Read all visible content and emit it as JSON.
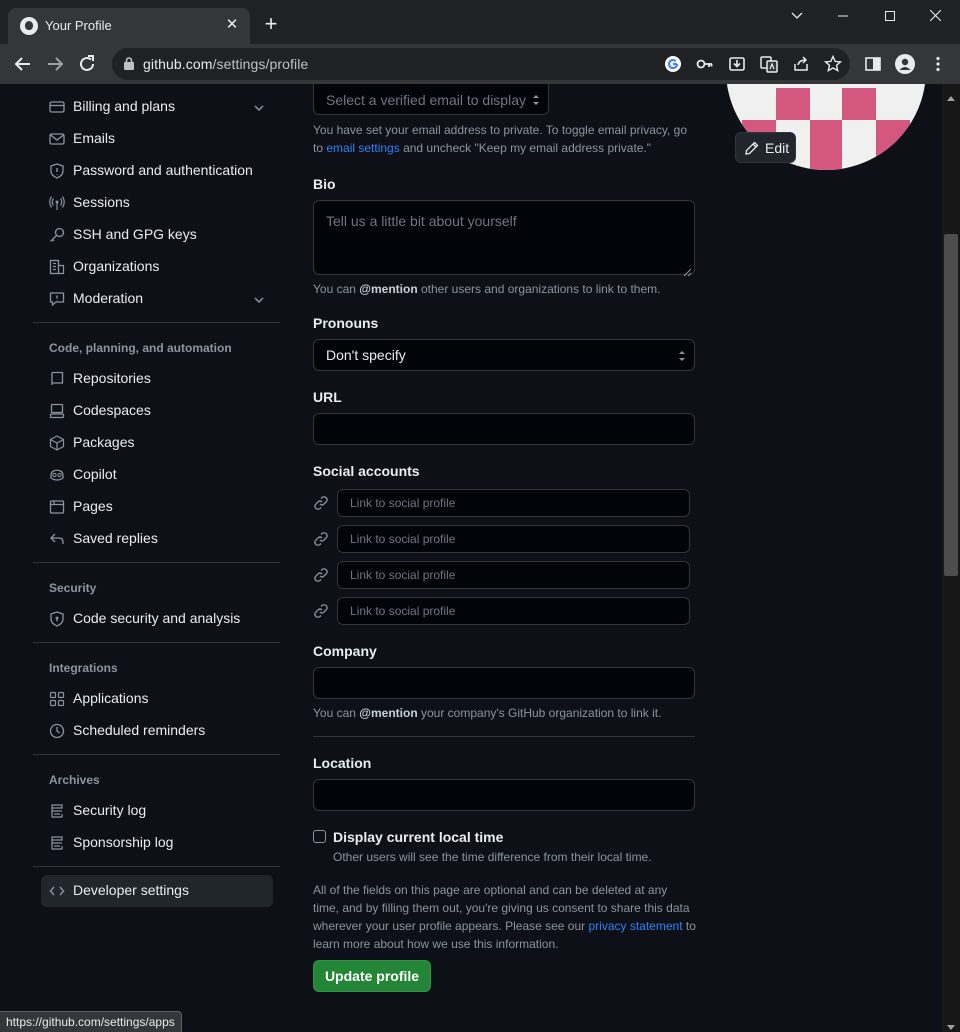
{
  "browser": {
    "tab_title": "Your Profile",
    "tab_close": "✕",
    "new_tab": "+",
    "window_controls": {
      "dropdown": "⌄",
      "minimize": "—",
      "maximize": "☐",
      "close": "✕"
    },
    "url_host": "github.com",
    "url_path": "/settings/profile",
    "status_url": "https://github.com/settings/apps"
  },
  "sidebar": {
    "items_top": [
      {
        "label": "Billing and plans",
        "icon": "credit-card-icon",
        "expandable": true
      },
      {
        "label": "Emails",
        "icon": "mail-icon"
      },
      {
        "label": "Password and authentication",
        "icon": "shield-icon"
      },
      {
        "label": "Sessions",
        "icon": "broadcast-icon"
      },
      {
        "label": "SSH and GPG keys",
        "icon": "key-icon"
      },
      {
        "label": "Organizations",
        "icon": "organization-icon"
      },
      {
        "label": "Moderation",
        "icon": "report-icon",
        "expandable": true
      }
    ],
    "section_code": "Code, planning, and automation",
    "items_code": [
      {
        "label": "Repositories",
        "icon": "repo-icon"
      },
      {
        "label": "Codespaces",
        "icon": "codespaces-icon"
      },
      {
        "label": "Packages",
        "icon": "package-icon"
      },
      {
        "label": "Copilot",
        "icon": "copilot-icon"
      },
      {
        "label": "Pages",
        "icon": "browser-icon"
      },
      {
        "label": "Saved replies",
        "icon": "reply-icon"
      }
    ],
    "section_security": "Security",
    "items_security": [
      {
        "label": "Code security and analysis",
        "icon": "shield-lock-icon"
      }
    ],
    "section_integrations": "Integrations",
    "items_integrations": [
      {
        "label": "Applications",
        "icon": "apps-icon"
      },
      {
        "label": "Scheduled reminders",
        "icon": "clock-icon"
      }
    ],
    "section_archives": "Archives",
    "items_archives": [
      {
        "label": "Security log",
        "icon": "log-icon"
      },
      {
        "label": "Sponsorship log",
        "icon": "log-icon"
      }
    ],
    "developer_settings": {
      "label": "Developer settings",
      "icon": "code-icon",
      "active": true
    }
  },
  "form": {
    "public_email_placeholder": "Select a verified email to display",
    "email_help_1": "You have set your email address to private. To toggle email privacy, go",
    "email_help_2_prefix": "to",
    "email_help_link": "email settings",
    "email_help_2_suffix": "and uncheck \"Keep my email address private.\"",
    "bio_label": "Bio",
    "bio_placeholder": "Tell us a little bit about yourself",
    "bio_help_prefix": "You can",
    "bio_help_mention": "@mention",
    "bio_help_suffix": "other users and organizations to link to them.",
    "pronouns_label": "Pronouns",
    "pronouns_value": "Don't specify",
    "url_label": "URL",
    "url_value": "",
    "social_label": "Social accounts",
    "social_placeholder": "Link to social profile",
    "company_label": "Company",
    "company_value": "",
    "company_help_prefix": "You can",
    "company_help_mention": "@mention",
    "company_help_suffix": "your company's GitHub organization to link it.",
    "location_label": "Location",
    "location_value": "",
    "local_time_label": "Display current local time",
    "local_time_checked": false,
    "local_time_help": "Other users will see the time difference from their local time.",
    "consent_1": "All of the fields on this page are optional and can be deleted at any",
    "consent_2": "time, and by filling them out, you're giving us consent to share this data",
    "consent_3_prefix": "wherever your user profile appears. Please see our",
    "consent_link": "privacy statement",
    "consent_3_suffix": "to",
    "consent_4": "learn more about how we use this information.",
    "submit_label": "Update profile"
  },
  "avatar": {
    "edit_label": "Edit",
    "accent_color": "#d3577f"
  },
  "colors": {
    "bg": "#0d1117",
    "accent_blue": "#2f81f7",
    "button_green": "#238636"
  }
}
